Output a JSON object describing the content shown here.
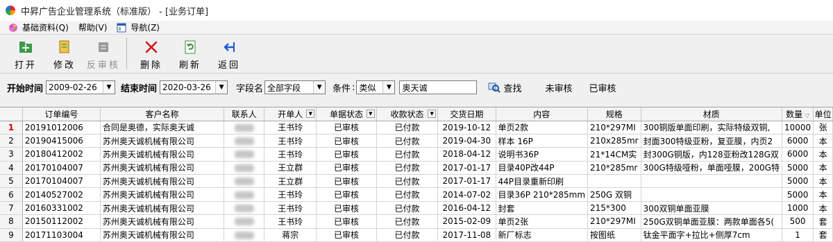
{
  "window": {
    "title": "中昇广告企业管理系统（标准版） - [业务订单]"
  },
  "menu": [
    {
      "label": "基础资料(Q)",
      "icon": "palette-icon"
    },
    {
      "label": "帮助(V)",
      "icon": "none"
    },
    {
      "label": "导航(Z)",
      "icon": "window-icon"
    }
  ],
  "toolbar": {
    "open": "打开",
    "edit": "修改",
    "unapprove": "反审核",
    "delete": "删除",
    "refresh": "刷新",
    "back": "返回"
  },
  "filter": {
    "start_label": "开始时间",
    "start_value": "2009-02-26",
    "end_label": "结束时间",
    "end_value": "2020-03-26",
    "field_label": "字段名",
    "field_value": "全部字段",
    "cond_label": "条件",
    "cond_value": "类似",
    "keyword": "奥天诚",
    "search": "查找",
    "unapproved": "未审核",
    "approved": "已审核"
  },
  "table": {
    "columns": [
      "",
      "订单编号",
      "客户名称",
      "联系人",
      "开单人",
      "单据状态",
      "收款状态",
      "交货日期",
      "内容",
      "规格",
      "材质",
      "数量",
      "单位"
    ],
    "rows": [
      [
        "1",
        "20191012006",
        "合同是奥德，实际奥天诚",
        "",
        "王书玲",
        "已审核",
        "已付款",
        "2019-10-12",
        "单页2款",
        "210*297MI",
        "300铜版单面印刷，实际特级双铜,",
        "10000",
        "张"
      ],
      [
        "2",
        "20190415006",
        "苏州奥天诚机械有限公司",
        "",
        "王书玲",
        "已审核",
        "已付款",
        "2019-04-30",
        "样本 16P",
        "210x285mr",
        "封面300特级亚粉，复亚膜，内页2",
        "6000",
        "本"
      ],
      [
        "3",
        "20180412002",
        "苏州奥天诚机械有限公司",
        "",
        "王书玲",
        "已审核",
        "已付款",
        "2018-04-12",
        "说明书36P",
        "21*14CM实",
        "封300G铜版，内128亚粉改128G双",
        "6000",
        "本"
      ],
      [
        "4",
        "20170104007",
        "苏州奥天诚机械有限公司",
        "",
        "王立群",
        "已审核",
        "已付款",
        "2017-01-17",
        "目录40P改44P",
        "210*285mr",
        "300G特级哑粉，单面哑膜，200G特",
        "5000",
        "本"
      ],
      [
        "5",
        "20170104007",
        "苏州奥天诚机械有限公司",
        "",
        "王立群",
        "已审核",
        "已付款",
        "2017-01-17",
        "44P目录重新印刷",
        "",
        "",
        "5000",
        "本"
      ],
      [
        "6",
        "20140527002",
        "苏州奥天诚机械有限公司",
        "",
        "王书玲",
        "已审核",
        "已付款",
        "2014-07-02",
        "目录36P  210*285mm",
        "250G 双铜",
        "",
        "5000",
        "本"
      ],
      [
        "7",
        "20160331002",
        "苏州奥天诚机械有限公司",
        "",
        "王书玲",
        "已审核",
        "已付款",
        "2016-04-12",
        "封套",
        "215*300",
        "300双铜单面亚膜",
        "1000",
        "本"
      ],
      [
        "8",
        "20150112002",
        "苏州奥天诚机械有限公司",
        "",
        "王书玲",
        "已审核",
        "已付款",
        "2015-02-09",
        "单页2张",
        "210*297MI",
        "250G双铜单面亚膜：两款单面各5(",
        "500",
        "套"
      ],
      [
        "9",
        "20171103004",
        "苏州奥天诚机械有限公司",
        "",
        "蒋宗",
        "已审核",
        "已付款",
        "2017-11-08",
        "新厂标志",
        "按图纸",
        "钛金平面字+拉比+侧厚7cm",
        "1",
        "套"
      ]
    ]
  }
}
